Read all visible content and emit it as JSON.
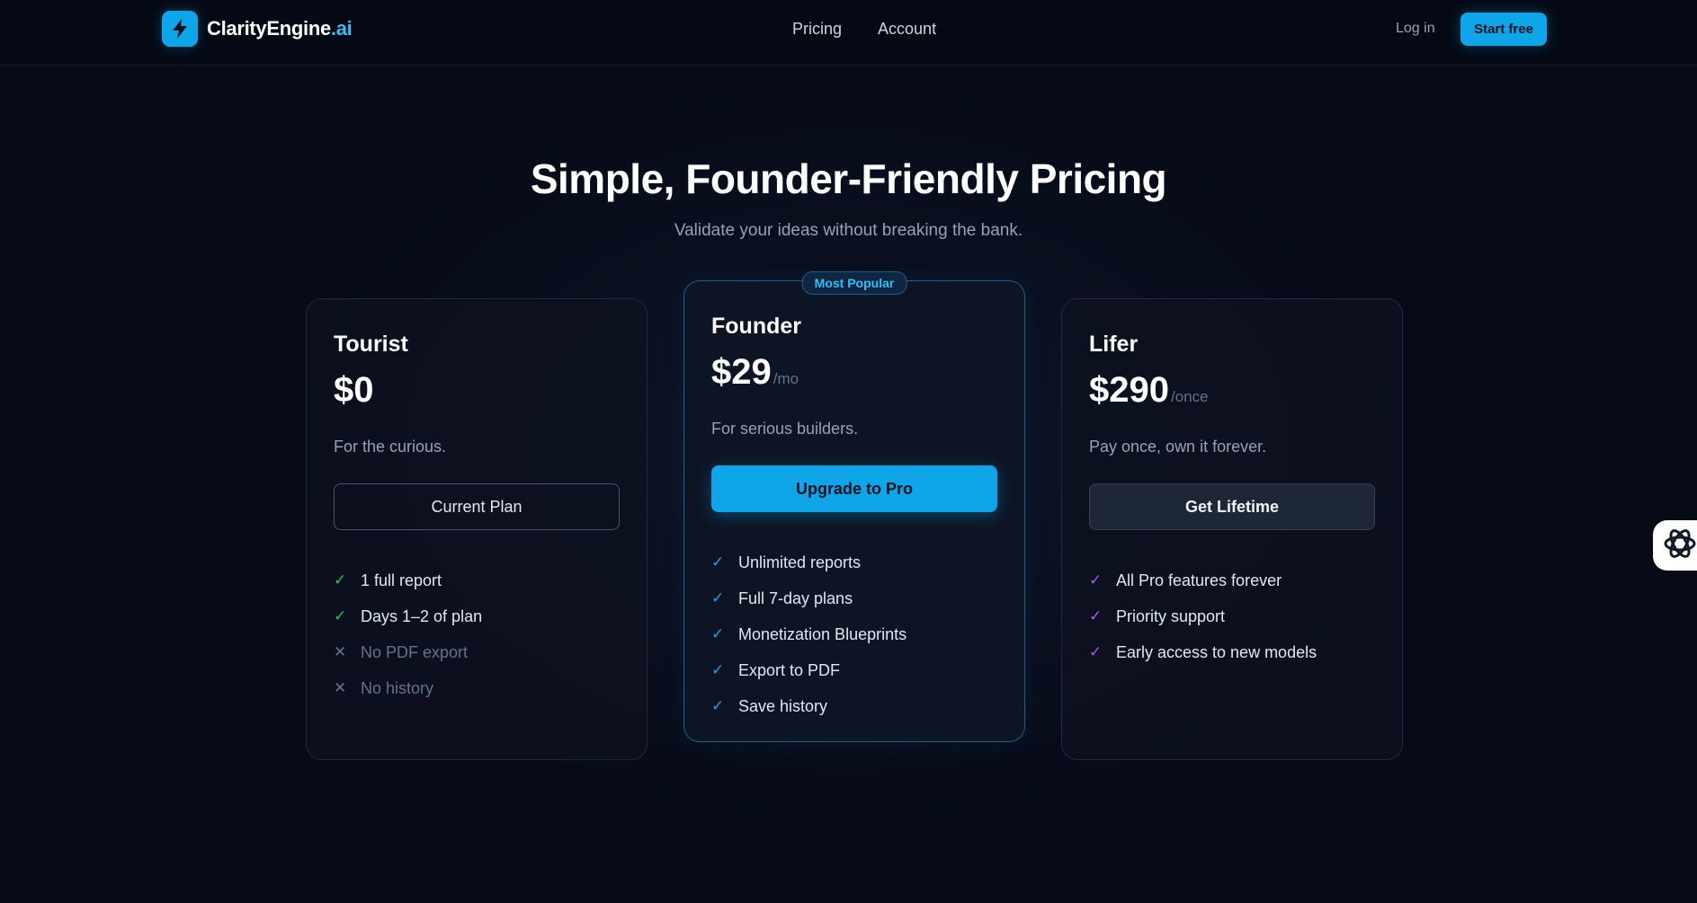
{
  "header": {
    "logo_name": "ClarityEngine",
    "logo_tld": ".ai",
    "logo_icon": "lightning-bolt-icon",
    "nav": [
      "Pricing",
      "Account"
    ],
    "login_label": "Log in",
    "start_label": "Start free"
  },
  "hero": {
    "title": "Simple, Founder-Friendly Pricing",
    "subtitle": "Validate your ideas without breaking the bank."
  },
  "plans": [
    {
      "name": "Tourist",
      "price": "$0",
      "period": "",
      "tagline": "For the curious.",
      "cta": "Current Plan",
      "features": [
        {
          "text": "1 full report",
          "mark": "✓",
          "included": true
        },
        {
          "text": "Days 1–2 of plan",
          "mark": "✓",
          "included": true
        },
        {
          "text": "No PDF export",
          "mark": "✕",
          "included": false
        },
        {
          "text": "No history",
          "mark": "✕",
          "included": false
        }
      ]
    },
    {
      "badge": "Most Popular",
      "name": "Founder",
      "price": "$29",
      "period": "/mo",
      "tagline": "For serious builders.",
      "cta": "Upgrade to Pro",
      "features": [
        {
          "text": "Unlimited reports",
          "mark": "✓",
          "included": true
        },
        {
          "text": "Full 7-day plans",
          "mark": "✓",
          "included": true
        },
        {
          "text": "Monetization Blueprints",
          "mark": "✓",
          "included": true
        },
        {
          "text": "Export to PDF",
          "mark": "✓",
          "included": true
        },
        {
          "text": "Save history",
          "mark": "✓",
          "included": true
        }
      ]
    },
    {
      "name": "Lifer",
      "price": "$290",
      "period": "/once",
      "tagline": "Pay once, own it forever.",
      "cta": "Get Lifetime",
      "features": [
        {
          "text": "All Pro features forever",
          "mark": "✓",
          "included": true
        },
        {
          "text": "Priority support",
          "mark": "✓",
          "included": true
        },
        {
          "text": "Early access to new models",
          "mark": "✓",
          "included": true
        }
      ]
    }
  ],
  "colors": {
    "accent": "#0ea5e9",
    "background": "#070b18",
    "check_green": "#22c55e",
    "check_purple": "#a855f7"
  },
  "floating_widget_icon": "openai-logo-icon"
}
